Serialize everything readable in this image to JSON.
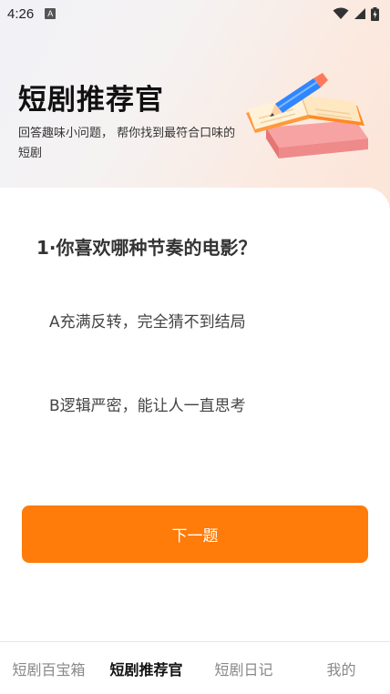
{
  "status_bar": {
    "time": "4:26",
    "indicator": "A",
    "icons": [
      "wifi-icon",
      "signal-icon",
      "battery-charging-icon"
    ]
  },
  "hero": {
    "title": "短剧推荐官",
    "subtitle": "回答趣味小问题， 帮你找到最符合口味的短剧",
    "illustration": "book-pencil-illustration"
  },
  "quiz": {
    "question": "1·你喜欢哪种节奏的电影？",
    "options": [
      {
        "label": "A充满反转，完全猜不到结局"
      },
      {
        "label": "B逻辑严密，能让人一直思考"
      }
    ],
    "next_label": "下一题"
  },
  "tabs": [
    {
      "label": "短剧百宝箱",
      "active": false
    },
    {
      "label": "短剧推荐官",
      "active": true
    },
    {
      "label": "短剧日记",
      "active": false
    },
    {
      "label": "我的",
      "active": false
    }
  ],
  "colors": {
    "accent": "#ff7b0a",
    "hero_gradient_end": "#fde3d6"
  }
}
